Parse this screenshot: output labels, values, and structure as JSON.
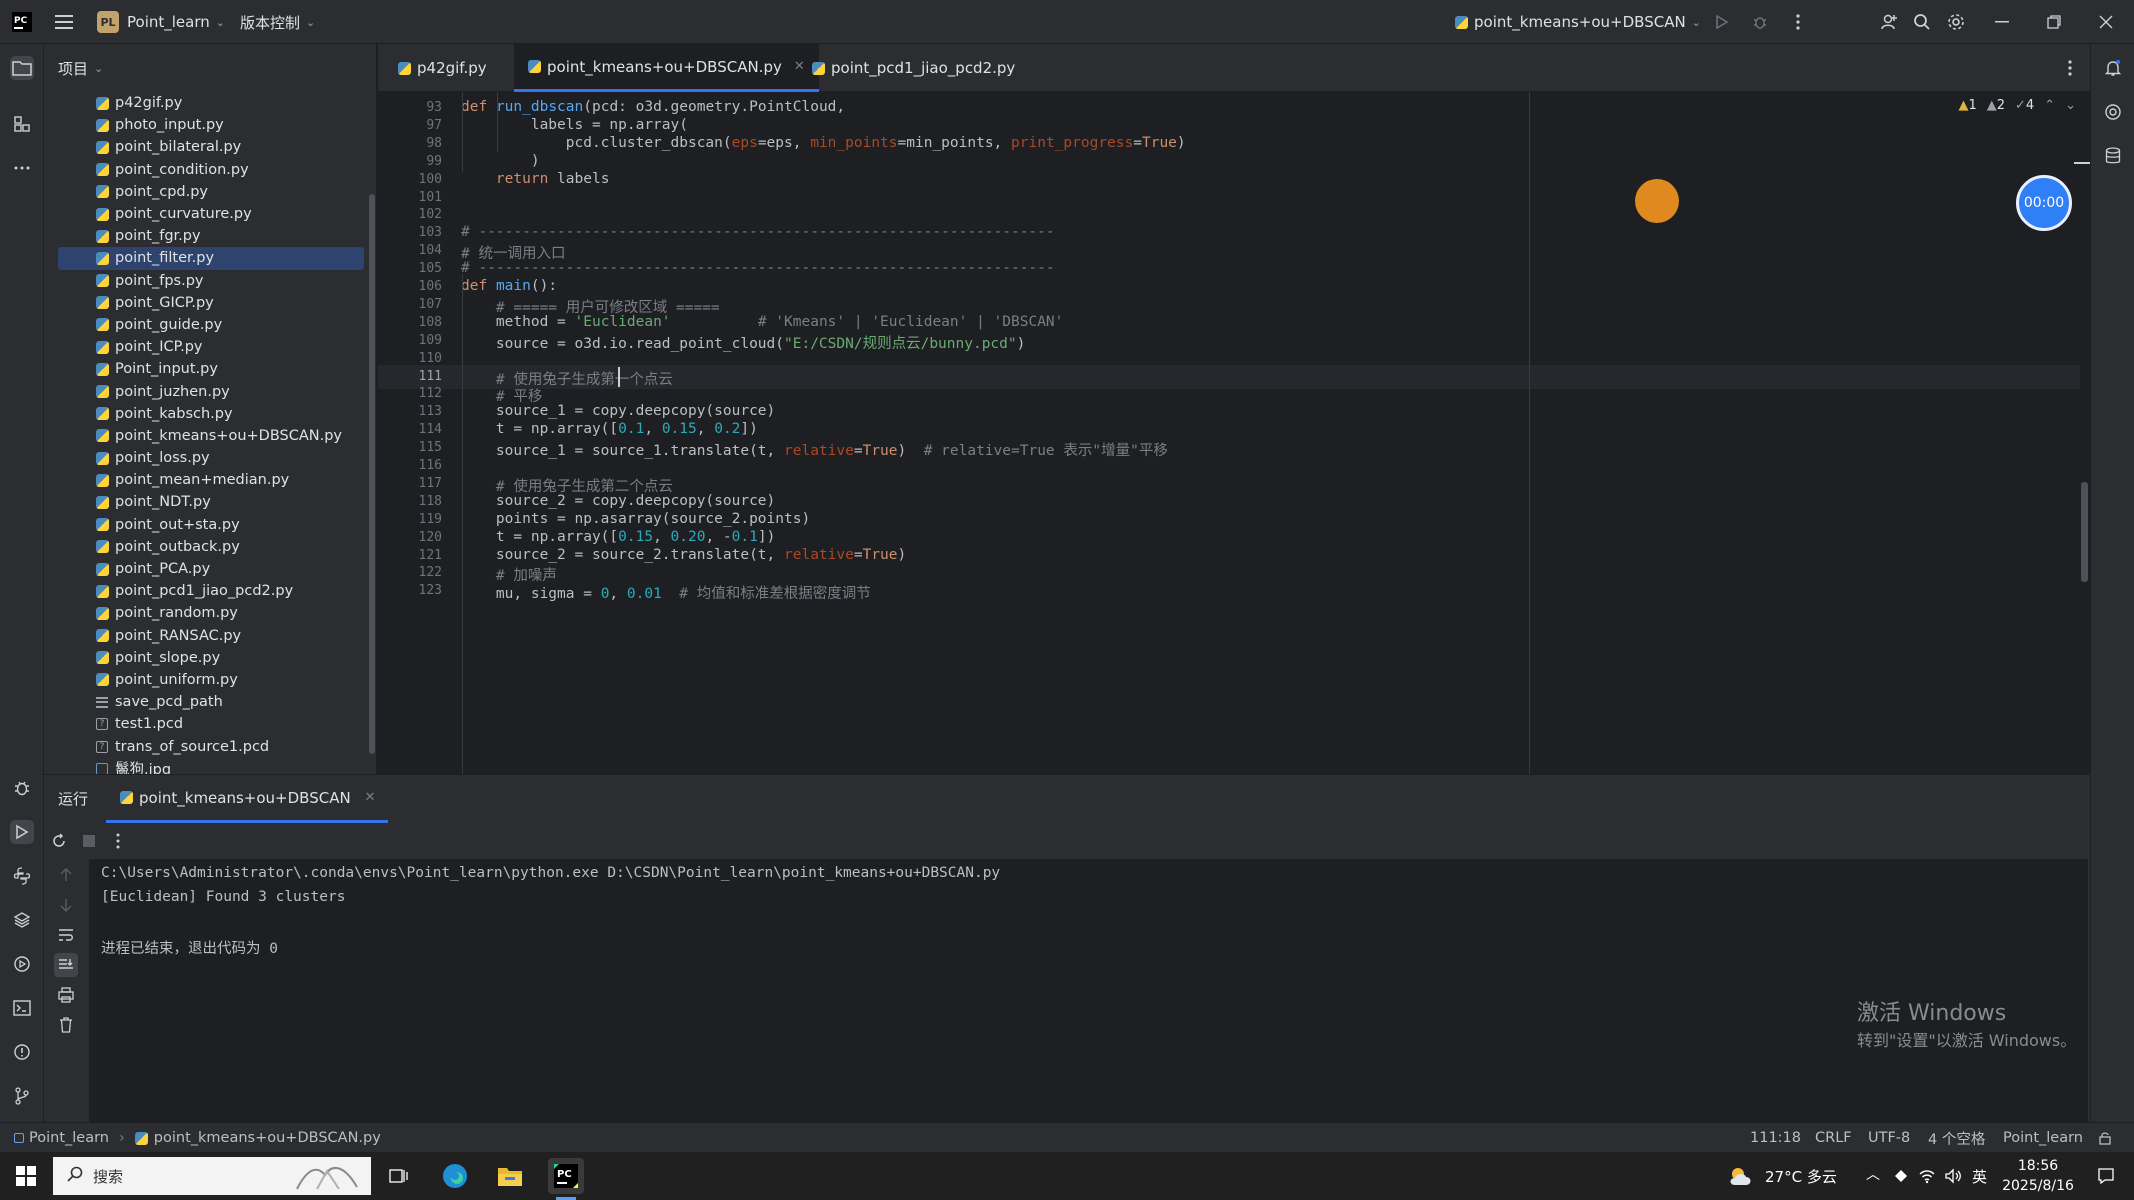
{
  "titlebar": {
    "project_name": "Point_learn",
    "project_badge": "PL",
    "vcs_label": "版本控制",
    "run_config": "point_kmeans+ou+DBSCAN"
  },
  "project_panel": {
    "title": "项目",
    "files": [
      {
        "name": "p42gif.py",
        "type": "py"
      },
      {
        "name": "photo_input.py",
        "type": "py"
      },
      {
        "name": "point_bilateral.py",
        "type": "py"
      },
      {
        "name": "point_condition.py",
        "type": "py"
      },
      {
        "name": "point_cpd.py",
        "type": "py"
      },
      {
        "name": "point_curvature.py",
        "type": "py"
      },
      {
        "name": "point_fgr.py",
        "type": "py"
      },
      {
        "name": "point_filter.py",
        "type": "py",
        "selected": true
      },
      {
        "name": "point_fps.py",
        "type": "py"
      },
      {
        "name": "point_GICP.py",
        "type": "py"
      },
      {
        "name": "point_guide.py",
        "type": "py"
      },
      {
        "name": "point_ICP.py",
        "type": "py"
      },
      {
        "name": "Point_input.py",
        "type": "py"
      },
      {
        "name": "point_juzhen.py",
        "type": "py"
      },
      {
        "name": "point_kabsch.py",
        "type": "py"
      },
      {
        "name": "point_kmeans+ou+DBSCAN.py",
        "type": "py"
      },
      {
        "name": "point_loss.py",
        "type": "py"
      },
      {
        "name": "point_mean+median.py",
        "type": "py"
      },
      {
        "name": "point_NDT.py",
        "type": "py"
      },
      {
        "name": "point_out+sta.py",
        "type": "py"
      },
      {
        "name": "point_outback.py",
        "type": "py"
      },
      {
        "name": "point_PCA.py",
        "type": "py"
      },
      {
        "name": "point_pcd1_jiao_pcd2.py",
        "type": "py"
      },
      {
        "name": "point_random.py",
        "type": "py"
      },
      {
        "name": "point_RANSAC.py",
        "type": "py"
      },
      {
        "name": "point_slope.py",
        "type": "py"
      },
      {
        "name": "point_uniform.py",
        "type": "py"
      },
      {
        "name": "save_pcd_path",
        "type": "txt"
      },
      {
        "name": "test1.pcd",
        "type": "unk"
      },
      {
        "name": "trans_of_source1.pcd",
        "type": "unk"
      },
      {
        "name": "鬣狗.jpg",
        "type": "img"
      }
    ]
  },
  "tabs": [
    {
      "label": "p42gif.py"
    },
    {
      "label": "point_kmeans+ou+DBSCAN.py",
      "active": true
    },
    {
      "label": "point_pcd1_jiao_pcd2.py"
    }
  ],
  "inspections": {
    "warnings": "1",
    "weak_warnings": "2",
    "typos": "4"
  },
  "editor": {
    "current_line": "111",
    "lines": [
      {
        "n": "93",
        "html": "<span class=\"kw\">def</span> <span class=\"fn\">run_dbscan</span>(pcd: o3d.geometry.PointCloud,"
      },
      {
        "n": "97",
        "html": "        labels = np.array("
      },
      {
        "n": "98",
        "html": "            pcd.cluster_dbscan(<span class=\"par\">eps</span>=eps, <span class=\"par\">min_points</span>=min_points, <span class=\"par\">print_progress</span>=<span class=\"kw\">True</span>)"
      },
      {
        "n": "99",
        "html": "        )"
      },
      {
        "n": "100",
        "html": "    <span class=\"kw\">return</span> labels"
      },
      {
        "n": "101",
        "html": ""
      },
      {
        "n": "102",
        "html": ""
      },
      {
        "n": "103",
        "html": "<span class=\"cm\"># ------------------------------------------------------------------</span>"
      },
      {
        "n": "104",
        "html": "<span class=\"cm\"># 统一调用入口</span>"
      },
      {
        "n": "105",
        "html": "<span class=\"cm\"># ------------------------------------------------------------------</span>"
      },
      {
        "n": "106",
        "html": "<span class=\"kw\">def</span> <span class=\"fn\">main</span>():"
      },
      {
        "n": "107",
        "html": "    <span class=\"cm\"># ===== 用户可修改区域 =====</span>"
      },
      {
        "n": "108",
        "html": "    method = <span class=\"str\">'Euclidean'</span>          <span class=\"cm\"># 'Kmeans' | 'Euclidean' | 'DBSCAN'</span>"
      },
      {
        "n": "109",
        "html": "    source = o3d.io.read_point_cloud(<span class=\"str\">\"E:/CSDN/规则点云/bunny.pcd\"</span>)"
      },
      {
        "n": "110",
        "html": ""
      },
      {
        "n": "111",
        "html": "    <span class=\"cm\"># 使用兔子生成第一个点云</span>"
      },
      {
        "n": "112",
        "html": "    <span class=\"cm\"># 平移</span>"
      },
      {
        "n": "113",
        "html": "    source_1 = copy.deepcopy(source)"
      },
      {
        "n": "114",
        "html": "    t = np.array([<span class=\"num\">0.1</span>, <span class=\"num\">0.15</span>, <span class=\"num\">0.2</span>])"
      },
      {
        "n": "115",
        "html": "    source_1 = source_1.translate(t, <span class=\"par\">relative</span>=<span class=\"kw\">True</span>)  <span class=\"cm\"># relative=True 表示\"增量\"平移</span>"
      },
      {
        "n": "116",
        "html": ""
      },
      {
        "n": "117",
        "html": "    <span class=\"cm\"># 使用兔子生成第二个点云</span>"
      },
      {
        "n": "118",
        "html": "    source_2 = copy.deepcopy(source)"
      },
      {
        "n": "119",
        "html": "    points = np.asarray(source_2.points)"
      },
      {
        "n": "120",
        "html": "    t = np.array([<span class=\"num\">0.15</span>, <span class=\"num\">0.20</span>, -<span class=\"num\">0.1</span>])"
      },
      {
        "n": "121",
        "html": "    source_2 = source_2.translate(t, <span class=\"par\">relative</span>=<span class=\"kw\">True</span>)"
      },
      {
        "n": "122",
        "html": "    <span class=\"cm\"># 加噪声</span>"
      },
      {
        "n": "123",
        "html": "    mu, sigma = <span class=\"num\">0</span>, <span class=\"num\">0.01</span>  <span class=\"cm\"># 均值和标准差根据密度调节</span>"
      }
    ]
  },
  "timer": "00:00",
  "run_panel": {
    "title": "运行",
    "tab_label": "point_kmeans+ou+DBSCAN",
    "output": [
      "C:\\Users\\Administrator\\.conda\\envs\\Point_learn\\python.exe D:\\CSDN\\Point_learn\\point_kmeans+ou+DBSCAN.py",
      "[Euclidean] Found 3 clusters",
      "",
      "进程已结束，退出代码为 0"
    ],
    "watermark_title": "激活 Windows",
    "watermark_sub": "转到\"设置\"以激活 Windows。"
  },
  "statusbar": {
    "breadcrumb_project": "Point_learn",
    "breadcrumb_file": "point_kmeans+ou+DBSCAN.py",
    "position": "111:18",
    "line_sep": "CRLF",
    "encoding": "UTF-8",
    "indent": "4 个空格",
    "interpreter": "Point_learn"
  },
  "taskbar": {
    "search_placeholder": "搜索",
    "weather": "27°C 多云",
    "ime": "英",
    "time": "18:56",
    "date": "2025/8/16"
  }
}
